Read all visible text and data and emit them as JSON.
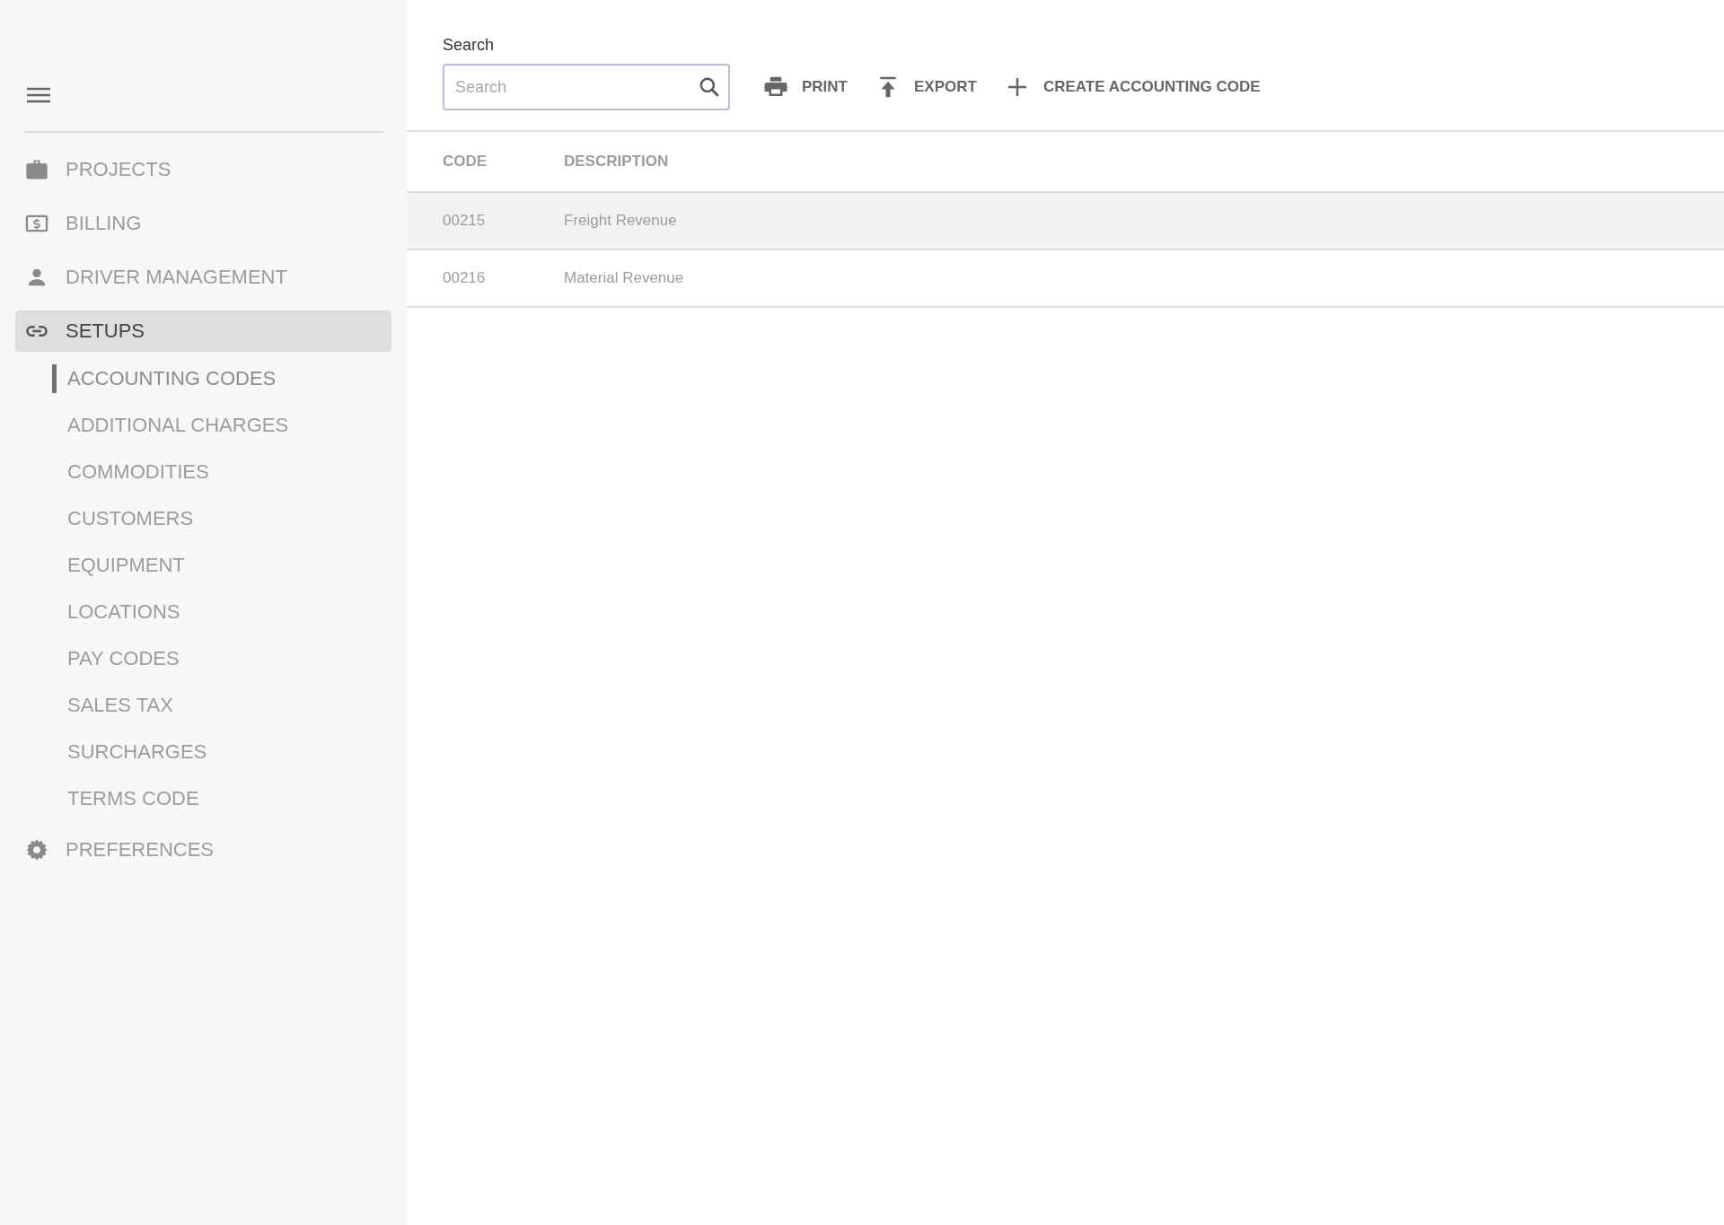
{
  "sidebar": {
    "items": [
      {
        "label": "PROJECTS",
        "selected": false
      },
      {
        "label": "BILLING",
        "selected": false
      },
      {
        "label": "DRIVER MANAGEMENT",
        "selected": false
      },
      {
        "label": "SETUPS",
        "selected": true,
        "children": [
          {
            "label": "ACCOUNTING CODES",
            "selected": true
          },
          {
            "label": "ADDITIONAL CHARGES",
            "selected": false
          },
          {
            "label": "COMMODITIES",
            "selected": false
          },
          {
            "label": "CUSTOMERS",
            "selected": false
          },
          {
            "label": "EQUIPMENT",
            "selected": false
          },
          {
            "label": "LOCATIONS",
            "selected": false
          },
          {
            "label": "PAY CODES",
            "selected": false
          },
          {
            "label": "SALES TAX",
            "selected": false
          },
          {
            "label": "SURCHARGES",
            "selected": false
          },
          {
            "label": "TERMS CODE",
            "selected": false
          }
        ]
      },
      {
        "label": "PREFERENCES",
        "selected": false
      }
    ]
  },
  "search": {
    "label": "Search",
    "placeholder": "Search"
  },
  "toolbar": [
    "PRINT",
    "EXPORT",
    "CREATE ACCOUNTING CODE"
  ],
  "table": {
    "columns": [
      "CODE",
      "DESCRIPTION"
    ],
    "rows": [
      {
        "cells": [
          "00215",
          "Freight Revenue"
        ],
        "selected": true
      },
      {
        "cells": [
          "00216",
          "Material Revenue"
        ],
        "selected": false
      }
    ]
  }
}
